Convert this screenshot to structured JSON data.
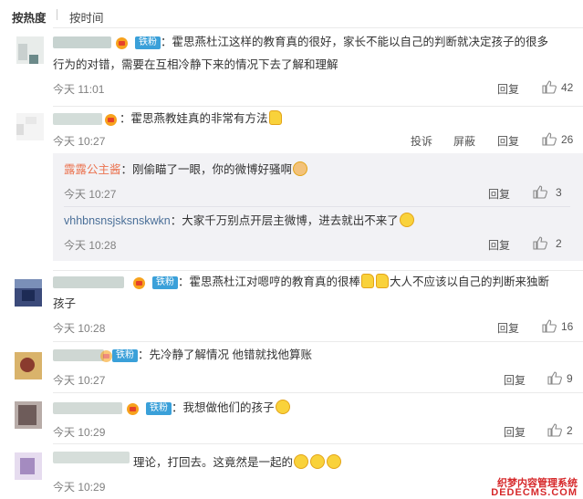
{
  "sort": {
    "hot": "按热度",
    "time": "按时间"
  },
  "comments": [
    {
      "fan_badge": "铁粉",
      "text_a": "：霍思燕杜江这样的教育真的很好，家长不能以自己的判断就决定孩子的很多",
      "text_b": "行为的对错，需要在互相冷静下来的情况下去了解和理解",
      "time": "今天 11:01",
      "reply": "回复",
      "likes": "42"
    },
    {
      "text_a": "：霍思燕教娃真的非常有方法",
      "time": "今天 10:27",
      "report": "投诉",
      "block": "屏蔽",
      "reply": "回复",
      "likes": "26",
      "replies": [
        {
          "user": "露露公主酱",
          "text": "：刚偷瞄了一眼，你的微博好骚啊",
          "time": "今天 10:27",
          "reply": "回复",
          "likes": "3"
        },
        {
          "user": "vhhbnsnsjsksnskwkn",
          "text": "：大家千万别点开层主微博，进去就出不来了",
          "time": "今天 10:28",
          "reply": "回复",
          "likes": "2"
        }
      ]
    },
    {
      "fan_badge": "铁粉",
      "text_a": "：霍思燕杜江对嗯哼的教育真的很棒",
      "text_a2": "大人不应该以自己的判断来独断",
      "text_b": "孩子",
      "time": "今天 10:28",
      "reply": "回复",
      "likes": "16"
    },
    {
      "fan_badge": "铁粉",
      "text_a": "：先冷静了解情况 他错就找他算账",
      "time": "今天 10:27",
      "reply": "回复",
      "likes": "9"
    },
    {
      "fan_badge": "铁粉",
      "text_a": "：我想做他们的孩子",
      "time": "今天 10:29",
      "reply": "回复",
      "likes": "2"
    },
    {
      "text_a": "理论，打回去。这竟然是一起的",
      "time": "今天 10:29"
    }
  ],
  "watermark": {
    "line1": "织梦内容管理系统",
    "line2": "DEDECMS.COM"
  },
  "colors": {
    "name_orange": "#eb7350",
    "name_blue": "#4a6f98",
    "fan_badge": "#3aa0d9",
    "reply_bg": "#f2f2f5"
  }
}
